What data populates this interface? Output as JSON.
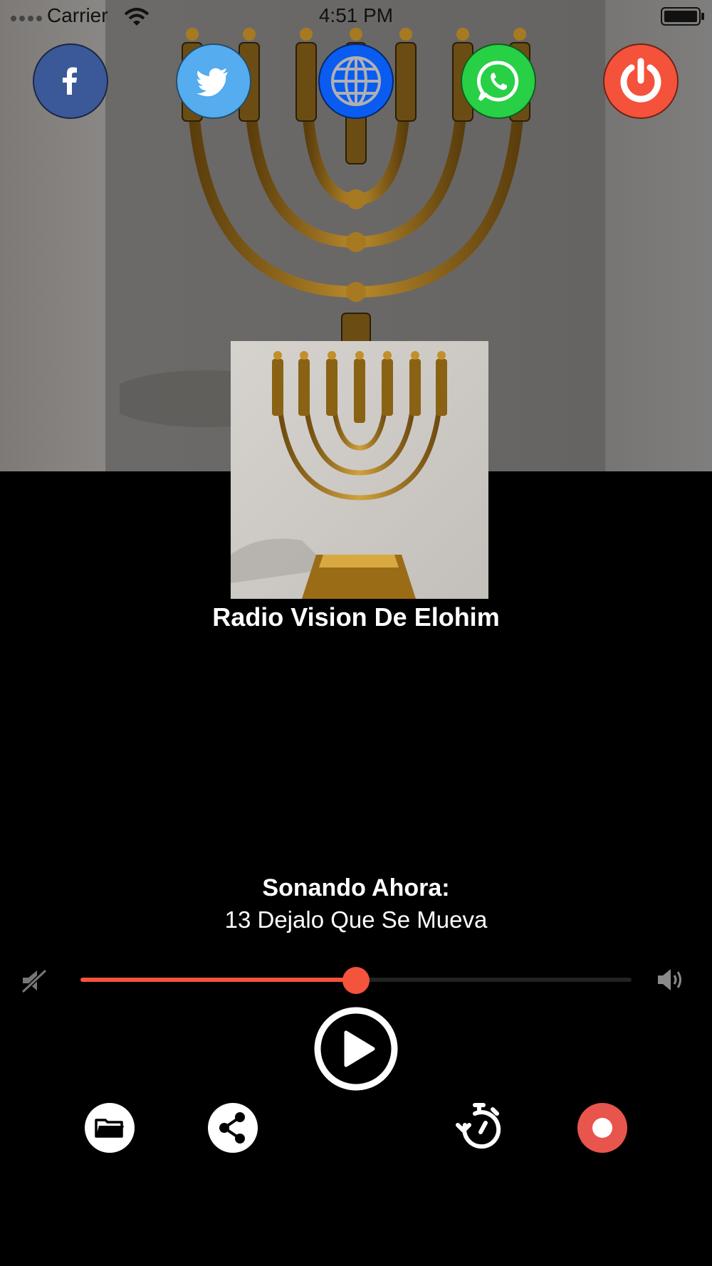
{
  "status_bar": {
    "carrier": "Carrier",
    "time": "4:51 PM"
  },
  "social": [
    {
      "id": "facebook",
      "icon": "facebook-icon",
      "color": "#3b5998"
    },
    {
      "id": "twitter",
      "icon": "twitter-icon",
      "color": "#55acee"
    },
    {
      "id": "website",
      "icon": "globe-icon",
      "color": "#0a5cf0"
    },
    {
      "id": "whatsapp",
      "icon": "whatsapp-icon",
      "color": "#27d045"
    },
    {
      "id": "power",
      "icon": "power-icon",
      "color": "#f4523b"
    }
  ],
  "station": {
    "name": "Radio Vision De Elohim"
  },
  "now_playing": {
    "label": "Sonando Ahora:",
    "track": "13 Dejalo Que Se Mueva"
  },
  "volume": {
    "level": 0.5,
    "accent": "#f4533c"
  },
  "controls": {
    "play_icon": "play-icon",
    "folder_icon": "folder-icon",
    "share_icon": "share-icon",
    "timer_icon": "timer-icon",
    "record_icon": "record-icon",
    "record_color": "#e8554d"
  }
}
